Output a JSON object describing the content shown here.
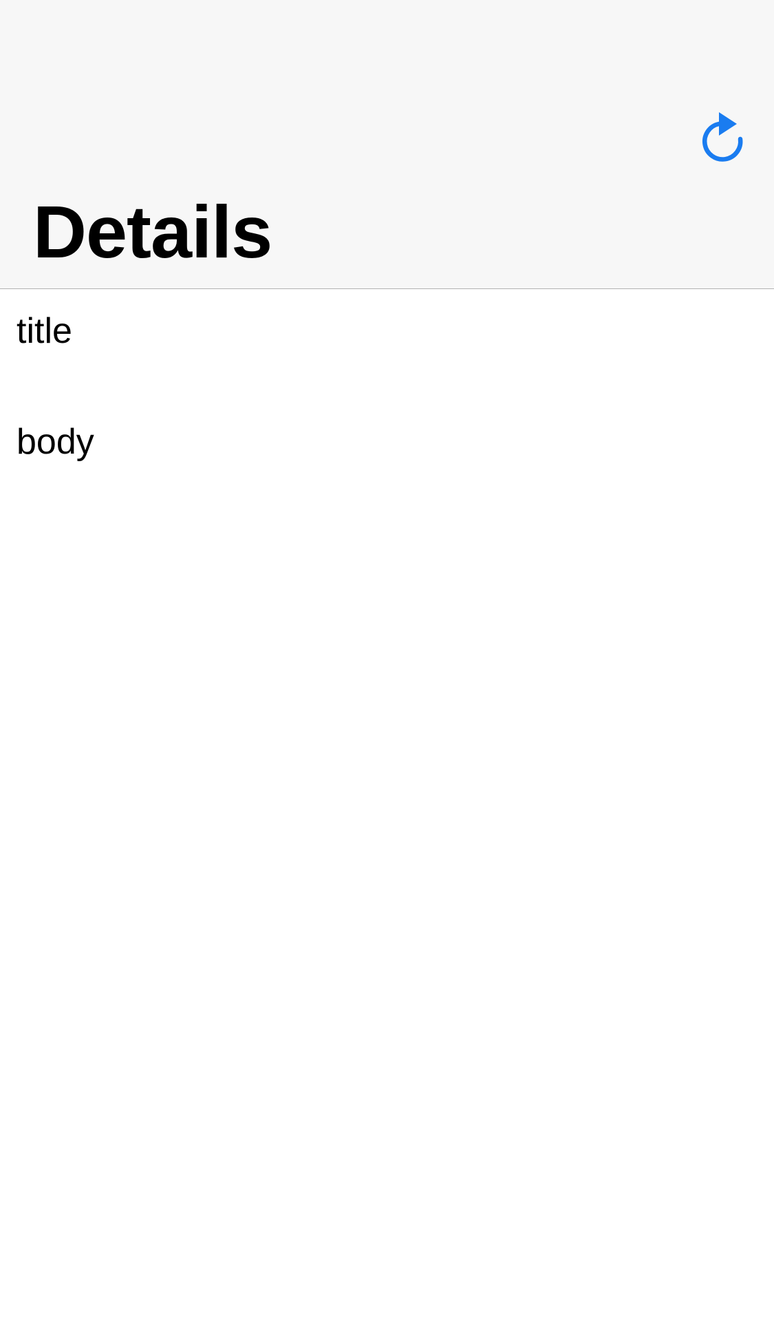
{
  "nav": {
    "title": "Details",
    "refresh_icon": "refresh-icon",
    "accent_color": "#1a7cf0",
    "background": "#f7f7f7"
  },
  "detail": {
    "title": "title",
    "body": "body"
  }
}
